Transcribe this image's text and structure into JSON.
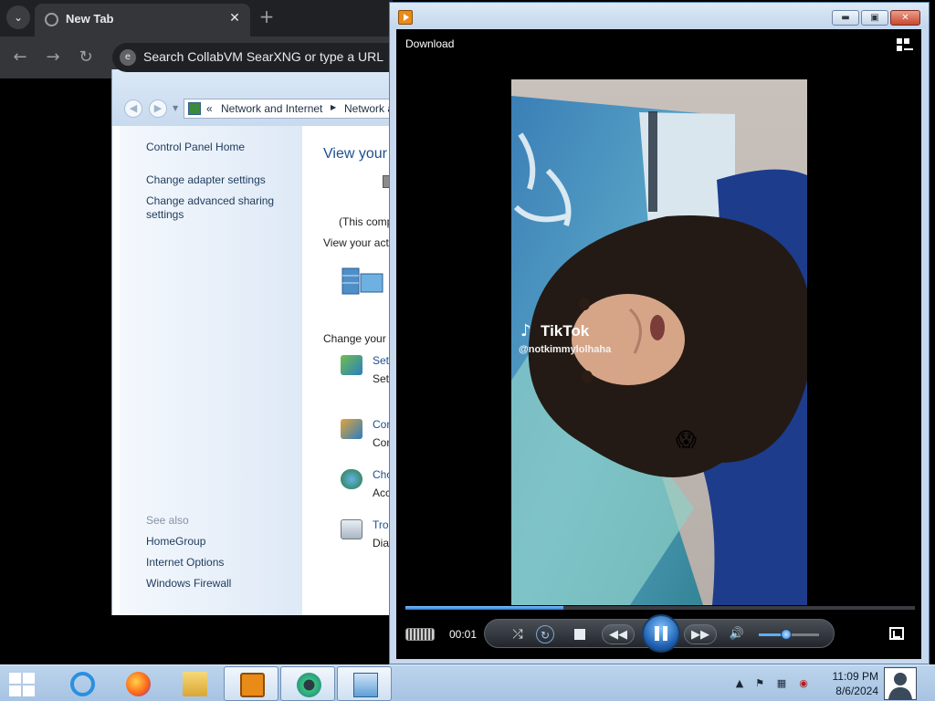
{
  "browser": {
    "tab_title": "New Tab",
    "tab_close": "✕",
    "new_tab": "+",
    "omnibox_placeholder": "Search CollabVM SearXNG or type a URL"
  },
  "control_panel": {
    "breadcrumb_chevron": "«",
    "breadcrumb": [
      "Network and Internet",
      "Network and Sharing Center"
    ],
    "sidebar": {
      "home": "Control Panel Home",
      "links": [
        "Change adapter settings",
        "Change advanced sharing settings"
      ],
      "see_also_label": "See also",
      "see_also": [
        "HomeGroup",
        "Internet Options",
        "Windows Firewall"
      ]
    },
    "main": {
      "title": "View your basic network information and set up connections",
      "this_computer": "(This computer)",
      "active_networks_label": "View your active networks",
      "change_settings_label": "Change your networking settings",
      "tasks": [
        {
          "title": "Set up a new connection or network",
          "desc": "Set up a wireless, broadband, dial-up, or VPN connection; or set up a router or access point."
        },
        {
          "title": "Connect to a network",
          "desc": "Connect or reconnect to a wireless, wired, dial-up, or VPN network connection."
        },
        {
          "title": "Choose homegroup and sharing options",
          "desc": "Access files and printers located on other network computers, or change sharing settings."
        },
        {
          "title": "Troubleshoot problems",
          "desc": "Diagnose and repair network problems, or get troubleshooting information."
        }
      ]
    }
  },
  "media_player": {
    "download_label": "Download",
    "video_overlay": {
      "brand": "TikTok",
      "handle": "@notkimmylolhaha",
      "emoji": "😱"
    },
    "time_elapsed": "00:01",
    "seek_progress": 0.31,
    "volume_level": 0.45,
    "state": "playing"
  },
  "taskbar": {
    "apps": [
      "Internet Explorer",
      "Firefox",
      "File Explorer",
      "Windows Media Player",
      "Chromium",
      "Control Panel"
    ],
    "clock_time": "11:09 PM",
    "clock_date": "8/6/2024"
  }
}
